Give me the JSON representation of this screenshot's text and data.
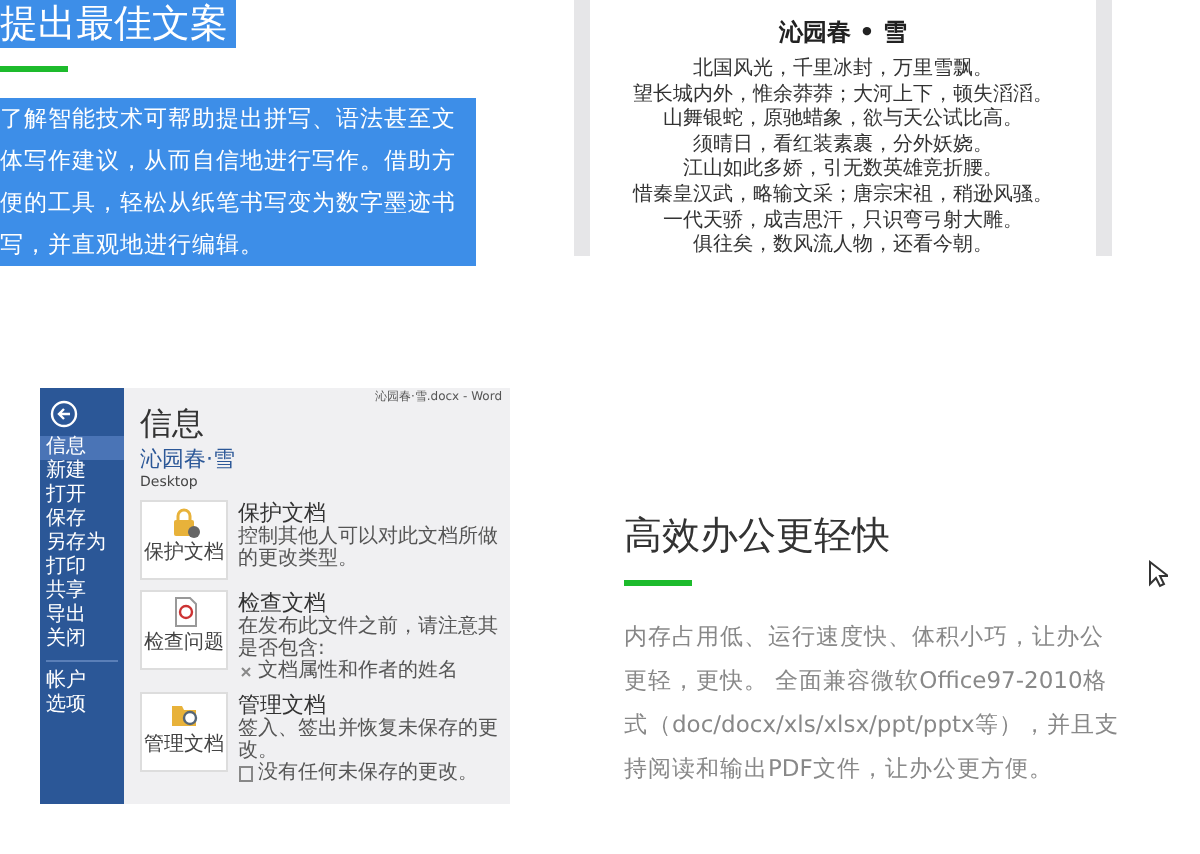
{
  "feature_top": {
    "heading": "提出最佳文案",
    "paragraph": "了解智能技术可帮助提出拼写、语法甚至文体写作建议，从而自信地进行写作。借助方便的工具，轻松从纸笔书写变为数字墨迹书写，并直观地进行编辑。",
    "selected": true
  },
  "document_preview": {
    "title": "沁园春 • 雪",
    "lines": [
      "北国风光，千里冰封，万里雪飘。",
      "望长城内外，惟余莽莽；大河上下，顿失滔滔。",
      "山舞银蛇，原驰蜡象，欲与天公试比高。",
      "须晴日，看红装素裹，分外妖娆。",
      "江山如此多娇，引无数英雄竞折腰。",
      "惜秦皇汉武，略输文采；唐宗宋祖，稍逊风骚。",
      "一代天骄，成吉思汗，只识弯弓射大雕。",
      "俱往矣，数风流人物，还看今朝。"
    ]
  },
  "word_screenshot": {
    "title": "沁园春·雪.docx - Word",
    "sidebar": {
      "items": [
        {
          "label": "信息",
          "selected": true
        },
        {
          "label": "新建",
          "selected": false
        },
        {
          "label": "打开",
          "selected": false
        },
        {
          "label": "保存",
          "selected": false
        },
        {
          "label": "另存为",
          "selected": false
        },
        {
          "label": "打印",
          "selected": false
        },
        {
          "label": "共享",
          "selected": false
        },
        {
          "label": "导出",
          "selected": false
        },
        {
          "label": "关闭",
          "selected": false
        }
      ],
      "footer_items": [
        {
          "label": "帐户",
          "selected": false
        },
        {
          "label": "选项",
          "selected": false
        }
      ]
    },
    "heading": "信息",
    "document_name": "沁园春·雪",
    "location": "Desktop",
    "sections": [
      {
        "kind": "protect",
        "button": "保护文档",
        "title": "保护文档",
        "description": "控制其他人可以对此文档所做的更改类型。"
      },
      {
        "kind": "inspect",
        "button": "检查问题",
        "title": "检查文档",
        "description": "在发布此文件之前，请注意其是否包含:",
        "bullets": [
          "文档属性和作者的姓名"
        ]
      },
      {
        "kind": "manage",
        "button": "管理文档",
        "title": "管理文档",
        "description": "签入、签出并恢复未保存的更改。",
        "bullets": [
          "没有任何未保存的更改。"
        ]
      }
    ]
  },
  "feature_bottom": {
    "heading": "高效办公更轻快",
    "paragraph": "内存占用低、运行速度快、体积小巧，让办公更轻，更快。 全面兼容微软Office97-2010格式（doc/docx/xls/xlsx/ppt/pptx等），并且支持阅读和输出PDF文件，让办公更方便。"
  }
}
